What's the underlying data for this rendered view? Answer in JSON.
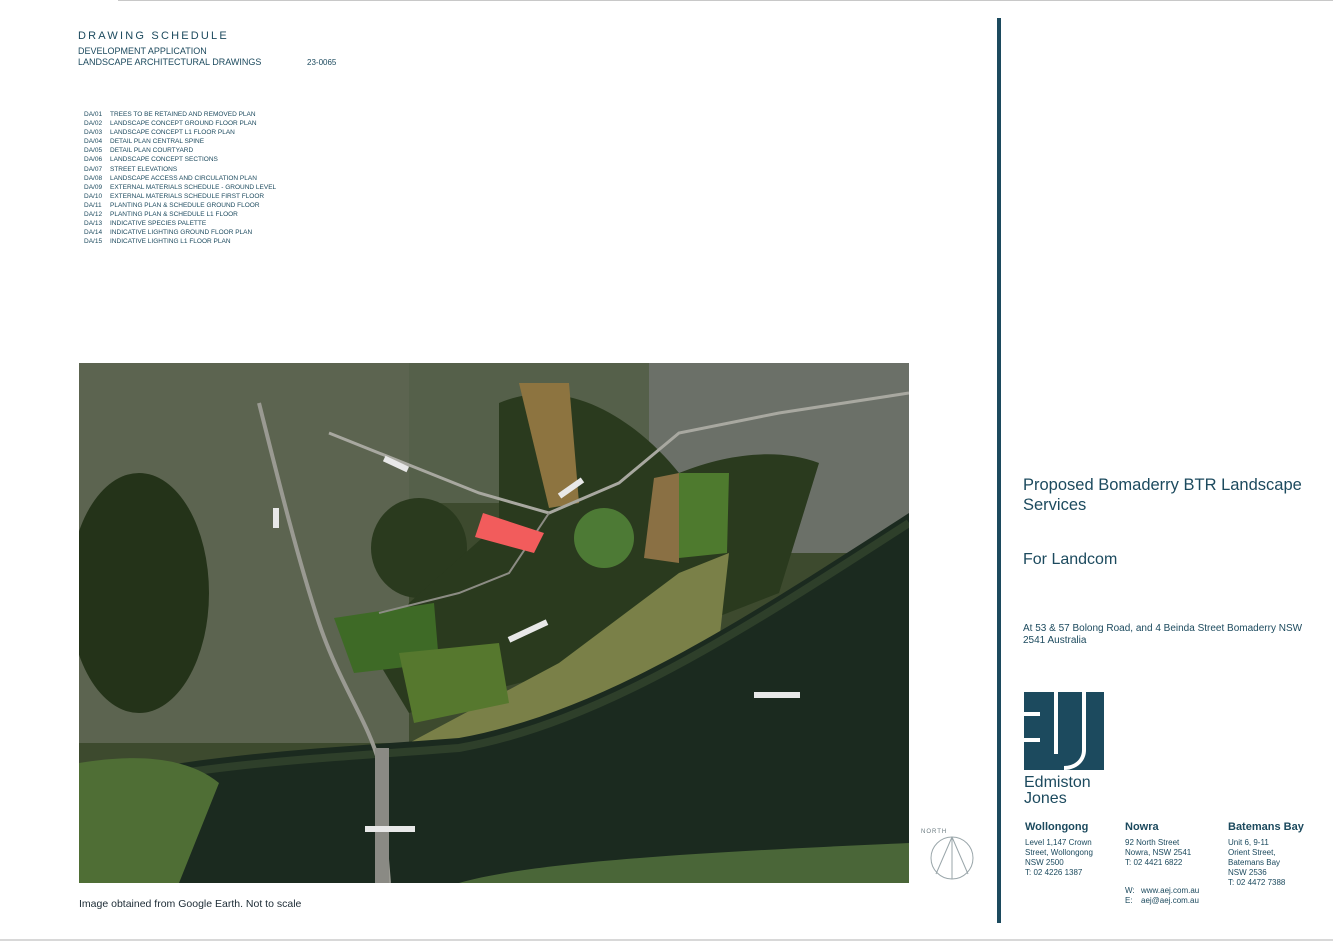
{
  "schedule": {
    "title": "DRAWING SCHEDULE",
    "subtitle1": "DEVELOPMENT APPLICATION",
    "subtitle2": "LANDSCAPE ARCHITECTURAL DRAWINGS",
    "project_number": "23-0065",
    "drawings": [
      {
        "code": "DA/01",
        "title": "TREES TO BE RETAINED AND REMOVED PLAN"
      },
      {
        "code": "DA/02",
        "title": "LANDSCAPE CONCEPT GROUND FLOOR PLAN"
      },
      {
        "code": "DA/03",
        "title": "LANDSCAPE CONCEPT L1 FLOOR PLAN"
      },
      {
        "code": "DA/04",
        "title": "DETAIL PLAN CENTRAL SPINE"
      },
      {
        "code": "DA/05",
        "title": "DETAIL PLAN COURTYARD"
      },
      {
        "code": "DA/06",
        "title": "LANDSCAPE CONCEPT SECTIONS"
      },
      {
        "code": "DA/07",
        "title": "STREET ELEVATIONS"
      },
      {
        "code": "DA/08",
        "title": "LANDSCAPE ACCESS AND CIRCULATION PLAN"
      },
      {
        "code": "DA/09",
        "title": "EXTERNAL MATERIALS SCHEDULE - GROUND LEVEL"
      },
      {
        "code": "DA/10",
        "title": "EXTERNAL MATERIALS SCHEDULE FIRST FLOOR"
      },
      {
        "code": "DA/11",
        "title": "PLANTING PLAN & SCHEDULE GROUND FLOOR"
      },
      {
        "code": "DA/12",
        "title": "PLANTING PLAN & SCHEDULE L1 FLOOR"
      },
      {
        "code": "DA/13",
        "title": "INDICATIVE SPECIES PALETTE"
      },
      {
        "code": "DA/14",
        "title": "INDICATIVE LIGHTING GROUND FLOOR PLAN"
      },
      {
        "code": "DA/15",
        "title": "INDICATIVE LIGHTING  L1 FLOOR PLAN"
      }
    ]
  },
  "map": {
    "caption": "Image obtained from Google Earth. Not to scale",
    "site_highlight_color": "#f25c5c",
    "north_label": "NORTH"
  },
  "title_block": {
    "project_title": "Proposed Bomaderry BTR Landscape Services",
    "client": "For Landcom",
    "address": "At 53 & 57 Bolong Road, and 4 Beinda Street Bomaderry NSW 2541 Australia",
    "accent_color": "#1c4a5e",
    "logo_line1": "Edmiston",
    "logo_line2": "Jones"
  },
  "offices": [
    {
      "name": "Wollongong",
      "lines": [
        "Level 1,147 Crown",
        "Street, Wollongong",
        "NSW 2500",
        "T: 02 4226 1387"
      ]
    },
    {
      "name": "Nowra",
      "lines": [
        "92 North Street",
        "Nowra, NSW 2541",
        "T: 02 4421 6822"
      ]
    },
    {
      "name": "Batemans Bay",
      "lines": [
        "Unit 6, 9-11",
        "Orient Street,",
        "Batemans Bay",
        "NSW 2536",
        "T: 02 4472 7388"
      ]
    }
  ],
  "contact": {
    "web_label": "W:",
    "web": "www.aej.com.au",
    "email_label": "E:",
    "email": "aej@aej.com.au"
  }
}
